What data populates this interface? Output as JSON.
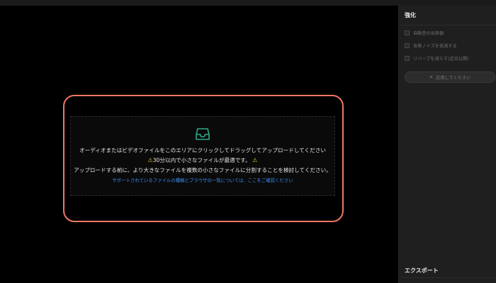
{
  "upload": {
    "main_text": "オーディオまたはビデオファイルをこのエリアにクリックしてドラッグしてアップロードしてください",
    "warning_text": "30分以内で小さなファイルが最適です。",
    "split_text": "アップロードする前に、より大きなファイルを複数の小さなファイルに分割することを検討してください。",
    "link_text": "サポートされているファイルの種類とブラウザの一覧については、ここをご確認ください",
    "icon": "inbox-icon",
    "border_color": "#f07766",
    "icon_color": "#2fa88a"
  },
  "sidebar": {
    "enhance_title": "強化",
    "options": [
      {
        "label": "自動音の出来器",
        "checked": false
      },
      {
        "label": "背景ノイズを低減する",
        "checked": false
      },
      {
        "label": "リバーブを減らす(近日公開)",
        "checked": false
      }
    ],
    "apply_button": "応用してください",
    "apply_icon": "close-icon",
    "export_title": "エクスポート"
  }
}
